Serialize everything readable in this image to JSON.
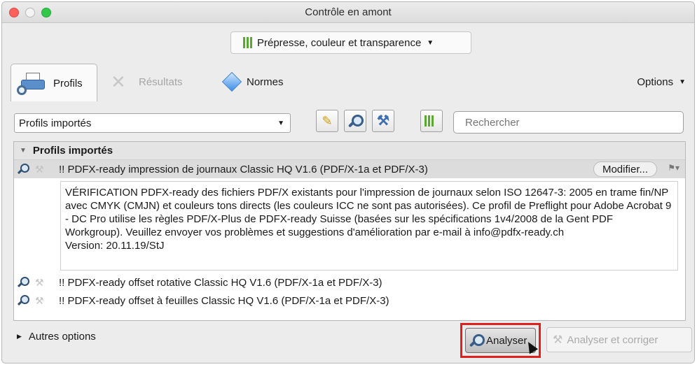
{
  "window": {
    "title": "Contrôle en amont"
  },
  "profile_category": {
    "label": "Prépresse, couleur et transparence"
  },
  "tabs": [
    {
      "label": "Profils",
      "active": true
    },
    {
      "label": "Résultats",
      "active": false
    },
    {
      "label": "Normes",
      "active": false
    }
  ],
  "options_label": "Options",
  "profile_select": {
    "value": "Profils importés"
  },
  "search": {
    "placeholder": "Rechercher"
  },
  "list": {
    "group_title": "Profils importés",
    "selected": {
      "name": "!! PDFX-ready impression de journaux Classic HQ V1.6 (PDF/X-1a et PDF/X-3)",
      "edit_label": "Modifier...",
      "description": "VÉRIFICATION PDFX-ready des fichiers PDF/X existants pour l'impression de journaux selon ISO 12647-3: 2005 en trame fin/NP avec CMYK (CMJN) et couleurs tons directs (les couleurs ICC ne sont pas autorisées). Ce profil de Preflight pour Adobe Acrobat 9 - DC Pro utilise les règles PDF/X-Plus de PDFX-ready Suisse (basées sur les spécifications 1v4/2008 de la Gent PDF Workgroup). Veuillez envoyer vos problèmes et suggestions d'amélioration par e-mail à info@pdfx-ready.ch",
      "version": "Version: 20.11.19/StJ"
    },
    "items": [
      "!! PDFX-ready offset rotative Classic HQ V1.6 (PDF/X-1a et PDF/X-3)",
      "!! PDFX-ready offset à feuilles Classic HQ V1.6 (PDF/X-1a et PDF/X-3)"
    ]
  },
  "more_options": "Autres options",
  "buttons": {
    "analyze": "Analyser",
    "analyze_fix": "Analyser et corriger"
  },
  "colors": {
    "highlight": "#e0201c",
    "bars": "#5aa832"
  }
}
